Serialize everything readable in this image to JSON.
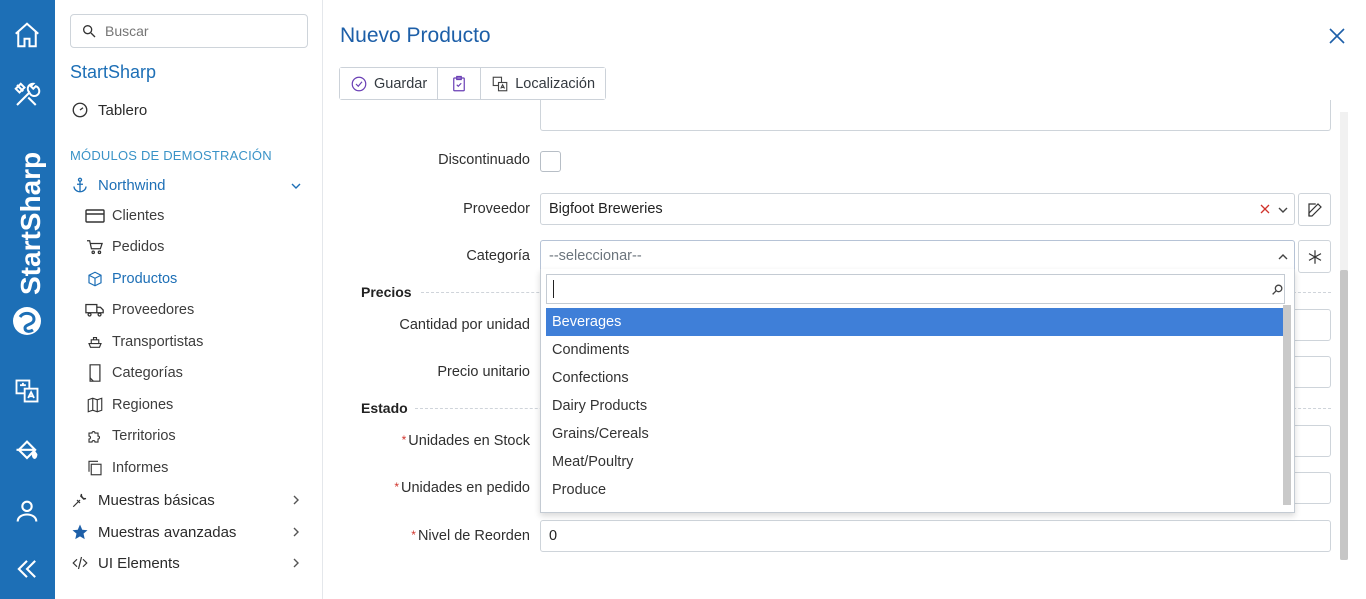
{
  "rail": {
    "brand_text": "StartSharp",
    "icons": [
      "home-icon",
      "tools-icon",
      "translate-icon",
      "paint-bucket-icon",
      "user-icon",
      "double-chevron-left-icon"
    ],
    "color": "#1d6fb6"
  },
  "sidebar": {
    "search_placeholder": "Buscar",
    "app_title": "StartSharp",
    "dashboard_label": "Tablero",
    "section_label": "MÓDULOS DE DEMOSTRACIÓN",
    "northwind_label": "Northwind",
    "northwind_items": [
      {
        "label": "Clientes",
        "icon": "card-icon"
      },
      {
        "label": "Pedidos",
        "icon": "cart-icon"
      },
      {
        "label": "Productos",
        "icon": "cube-icon"
      },
      {
        "label": "Proveedores",
        "icon": "truck-icon"
      },
      {
        "label": "Transportistas",
        "icon": "ship-icon"
      },
      {
        "label": "Categorías",
        "icon": "note-icon"
      },
      {
        "label": "Regiones",
        "icon": "map-icon"
      },
      {
        "label": "Territorios",
        "icon": "puzzle-icon"
      },
      {
        "label": "Informes",
        "icon": "copy-icon"
      }
    ],
    "groups": [
      {
        "label": "Muestras básicas",
        "icon": "wrench-icon"
      },
      {
        "label": "Muestras avanzadas",
        "icon": "star-icon"
      },
      {
        "label": "UI Elements",
        "icon": "code-icon"
      }
    ]
  },
  "dialog": {
    "title": "Nuevo Producto",
    "toolbar": {
      "save_label": "Guardar",
      "localization_label": "Localización"
    },
    "fields": {
      "discontinued_label": "Discontinuado",
      "supplier_label": "Proveedor",
      "supplier_value": "Bigfoot Breweries",
      "category_label": "Categoría",
      "category_placeholder": "--seleccionar--",
      "prices_section": "Precios",
      "quantity_label": "Cantidad por unidad",
      "unit_price_label": "Precio unitario",
      "status_section": "Estado",
      "units_stock_label": "Unidades en Stock",
      "units_order_label": "Unidades en pedido",
      "reorder_label": "Nivel de Reorden",
      "reorder_value": "0",
      "required_marker": "*"
    },
    "dropdown": {
      "options": [
        "Beverages",
        "Condiments",
        "Confections",
        "Dairy Products",
        "Grains/Cereals",
        "Meat/Poultry",
        "Produce"
      ],
      "selected_index": 0,
      "highlight_color": "#3f7fd8"
    }
  }
}
